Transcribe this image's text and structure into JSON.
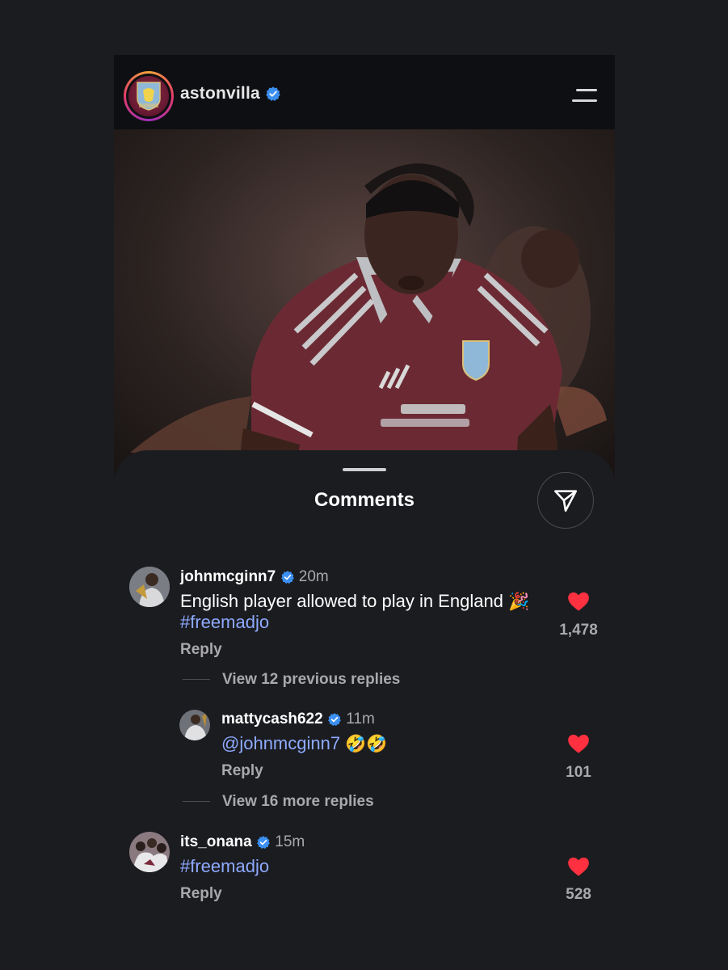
{
  "post": {
    "account": "astonvilla",
    "badge_text": "ASTON VILLA"
  },
  "sheet": {
    "title": "Comments"
  },
  "comments": [
    {
      "username": "johnmcginn7",
      "time": "20m",
      "text": "English player allowed to play in England",
      "emoji": "🎉",
      "hashtag": "#freemadjo",
      "reply_label": "Reply",
      "likes": "1,478",
      "view_replies": "View 12 previous replies"
    },
    {
      "username": "mattycash622",
      "time": "11m",
      "mention": "@johnmcginn7",
      "emoji": "🤣🤣",
      "reply_label": "Reply",
      "likes": "101",
      "view_replies": "View 16 more replies"
    },
    {
      "username": "its_onana",
      "time": "15m",
      "hashtag": "#freemadjo",
      "reply_label": "Reply",
      "likes": "528"
    }
  ],
  "colors": {
    "background": "#1b1c20",
    "mention": "#8eaaff",
    "heart": "#ff3040",
    "verified": "#3b8ff0"
  }
}
